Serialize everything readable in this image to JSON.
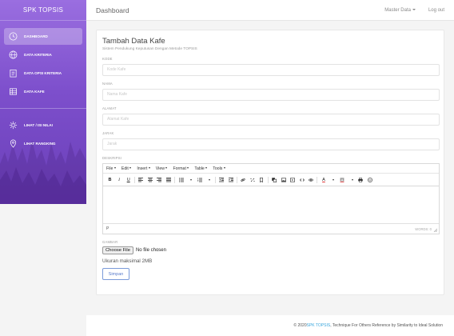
{
  "brand": "SPK TOPSIS",
  "sidebar": {
    "items": [
      {
        "label": "DASHBOARD",
        "icon": "clock-icon"
      },
      {
        "label": "DATA KRITERIA",
        "icon": "globe-icon"
      },
      {
        "label": "DATA OPSI KRITERIA",
        "icon": "clipboard-icon"
      },
      {
        "label": "DATA KAFE",
        "icon": "table-icon"
      },
      {
        "label": "LIHAT / ISI NILAI",
        "icon": "gear-icon"
      },
      {
        "label": "LIHAT RANGKING",
        "icon": "map-pin-icon"
      }
    ],
    "active_index": 0
  },
  "topbar": {
    "title": "Dashboard",
    "master_data": "Master Data",
    "logout": "Log out"
  },
  "form": {
    "title": "Tambah Data Kafe",
    "subtitle": "Sistem Pendukung Keputusan Dengan Metode TOPSIS",
    "fields": [
      {
        "label": "KODE",
        "placeholder": "Kode Kafe"
      },
      {
        "label": "NAMA",
        "placeholder": "Nama Kafe"
      },
      {
        "label": "ALAMAT",
        "placeholder": "Alamat Kafe"
      },
      {
        "label": "JARAK",
        "placeholder": "Jarak"
      }
    ],
    "deskripsi_label": "DESKRIPSI",
    "editor": {
      "menus": [
        "File",
        "Edit",
        "Insert",
        "View",
        "Format",
        "Table",
        "Tools"
      ],
      "status_path": "P",
      "words": "WORDS: 0"
    },
    "gambar_label": "GAMBAR",
    "file_button": "Choose File",
    "file_status": "No file chosen",
    "hint": "Ukuran maksimal 2MB",
    "save": "Simpan"
  },
  "footer": {
    "prefix": "© 2020 ",
    "link": "SPK TOPSIS",
    "suffix": ", Technique For Others Reference by Similarity to Ideal Solution"
  },
  "colors": {
    "sidebar_top": "#9a6ee0",
    "sidebar_bottom": "#6a3fb8",
    "link": "#3aa6dd",
    "save_border": "#7b9bd9"
  }
}
